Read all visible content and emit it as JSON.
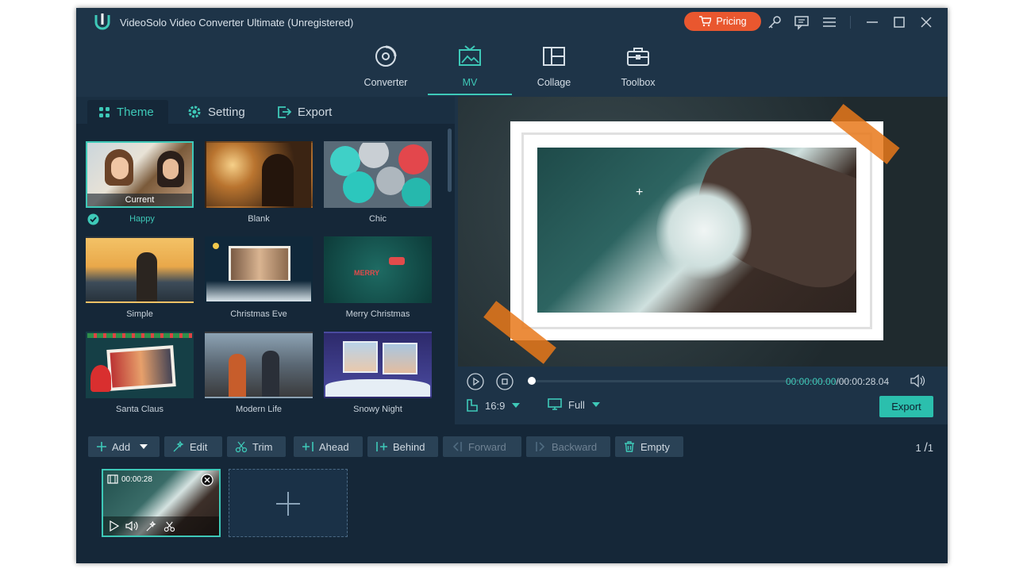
{
  "app": {
    "title": "VideoSolo Video Converter Ultimate (Unregistered)",
    "pricing_label": "Pricing"
  },
  "nav": [
    {
      "label": "Converter",
      "icon": "converter-icon"
    },
    {
      "label": "MV",
      "icon": "mv-icon"
    },
    {
      "label": "Collage",
      "icon": "collage-icon"
    },
    {
      "label": "Toolbox",
      "icon": "toolbox-icon"
    }
  ],
  "tabs": [
    {
      "label": "Theme",
      "icon": "theme-icon"
    },
    {
      "label": "Setting",
      "icon": "gear-icon"
    },
    {
      "label": "Export",
      "icon": "export-icon"
    }
  ],
  "themes": [
    {
      "label": "Happy",
      "current_tag": "Current"
    },
    {
      "label": "Blank"
    },
    {
      "label": "Chic"
    },
    {
      "label": "Simple"
    },
    {
      "label": "Christmas Eve"
    },
    {
      "label": "Merry Christmas"
    },
    {
      "label": "Santa Claus"
    },
    {
      "label": "Modern Life"
    },
    {
      "label": "Snowy Night"
    }
  ],
  "player": {
    "time": "00:00:00.00",
    "duration": "/00:00:28.04",
    "ratio": "16:9",
    "mode": "Full",
    "export_label": "Export",
    "progress": 0
  },
  "toolbar": {
    "add": "Add",
    "edit": "Edit",
    "trim": "Trim",
    "ahead": "Ahead",
    "behind": "Behind",
    "forward": "Forward",
    "backward": "Backward",
    "empty": "Empty",
    "page": "1",
    "page_total": "1"
  },
  "clip": {
    "duration": "00:00:28"
  },
  "colors": {
    "accent": "#3ec9b8",
    "pricing": "#e9572f",
    "background": "#1d3347"
  }
}
